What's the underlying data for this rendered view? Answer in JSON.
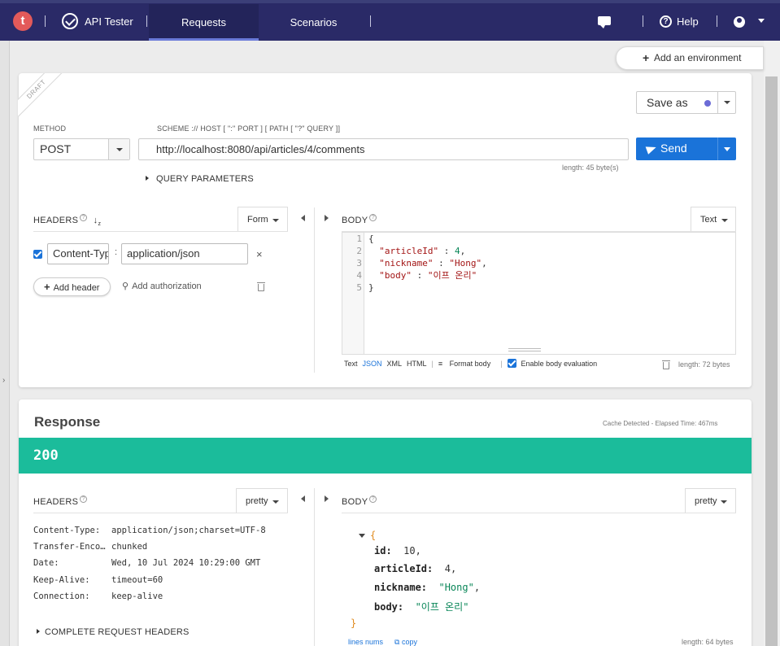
{
  "nav": {
    "logo": "t",
    "app_name": "API Tester",
    "tabs": [
      "Requests",
      "Scenarios"
    ],
    "help": "Help",
    "help_icon": "?"
  },
  "env": {
    "add_environment": "Add an environment"
  },
  "request": {
    "badge": "DRAFT",
    "save_as": "Save as",
    "method_label": "METHOD",
    "method": "POST",
    "scheme_label": "SCHEME :// HOST [ \":\" PORT ] [ PATH [ \"?\" QUERY ]]",
    "url": "http://localhost:8080/api/articles/4/comments",
    "url_length": "length: 45 byte(s)",
    "send": "Send",
    "query_parameters": "QUERY PARAMETERS",
    "headers_title": "HEADERS",
    "headers_mode": "Form",
    "headers": [
      {
        "name": "Content-Type",
        "value": "application/json",
        "enabled": true
      }
    ],
    "remove_header": "×",
    "add_header": "Add header",
    "add_authorization": "Add authorization",
    "body_title": "BODY",
    "body_mode": "Text",
    "body_lines": [
      "1",
      "2",
      "3",
      "4",
      "5"
    ],
    "body_code": {
      "open": "{",
      "k1": "\"articleId\"",
      "v1": "4",
      "k2": "\"nickname\"",
      "v2": "\"Hong\"",
      "k3": "\"body\"",
      "v3": "\"이프 온리\"",
      "close": "}"
    },
    "body_formats": [
      "Text",
      "JSON",
      "XML",
      "HTML"
    ],
    "active_format": "JSON",
    "format_body": "Format body",
    "enable_body_eval": "Enable body evaluation",
    "body_length": "length: 72 bytes"
  },
  "response": {
    "title": "Response",
    "meta": "Cache Detected - Elapsed Time: 467ms",
    "status": "200",
    "headers_title": "HEADERS",
    "headers_mode": "pretty",
    "headers": [
      {
        "key": "Content-Type:",
        "value": "application/json;charset=UTF-8"
      },
      {
        "key": "Transfer-Encoding:",
        "value": "chunked"
      },
      {
        "key": "Date:",
        "value": "Wed, 10 Jul 2024 10:29:00 GMT"
      },
      {
        "key": "Keep-Alive:",
        "value": "timeout=60"
      },
      {
        "key": "Connection:",
        "value": "keep-alive"
      }
    ],
    "complete_request_headers": "COMPLETE REQUEST HEADERS",
    "body_title": "BODY",
    "body_mode": "pretty",
    "json": {
      "open": "{",
      "fields": [
        {
          "key": "id:",
          "value": "10",
          "type": "num"
        },
        {
          "key": "articleId:",
          "value": "4",
          "type": "num"
        },
        {
          "key": "nickname:",
          "value": "\"Hong\"",
          "type": "str"
        },
        {
          "key": "body:",
          "value": "\"이프 온리\"",
          "type": "str"
        }
      ],
      "close": "}"
    },
    "lines_nums": "lines nums",
    "copy": "copy",
    "body_length": "length: 64 bytes"
  },
  "colors": {
    "nav_bg": "#2a2a67",
    "accent": "#1a73d9",
    "status_ok": "#1bbc9b",
    "logo": "#e35a5a"
  },
  "icons": [
    "check-circle-icon",
    "chat-icon",
    "help-icon",
    "user-icon",
    "plus-icon",
    "send-icon",
    "sort-icon",
    "key-icon",
    "trash-icon",
    "format-icon",
    "copy-icon"
  ]
}
